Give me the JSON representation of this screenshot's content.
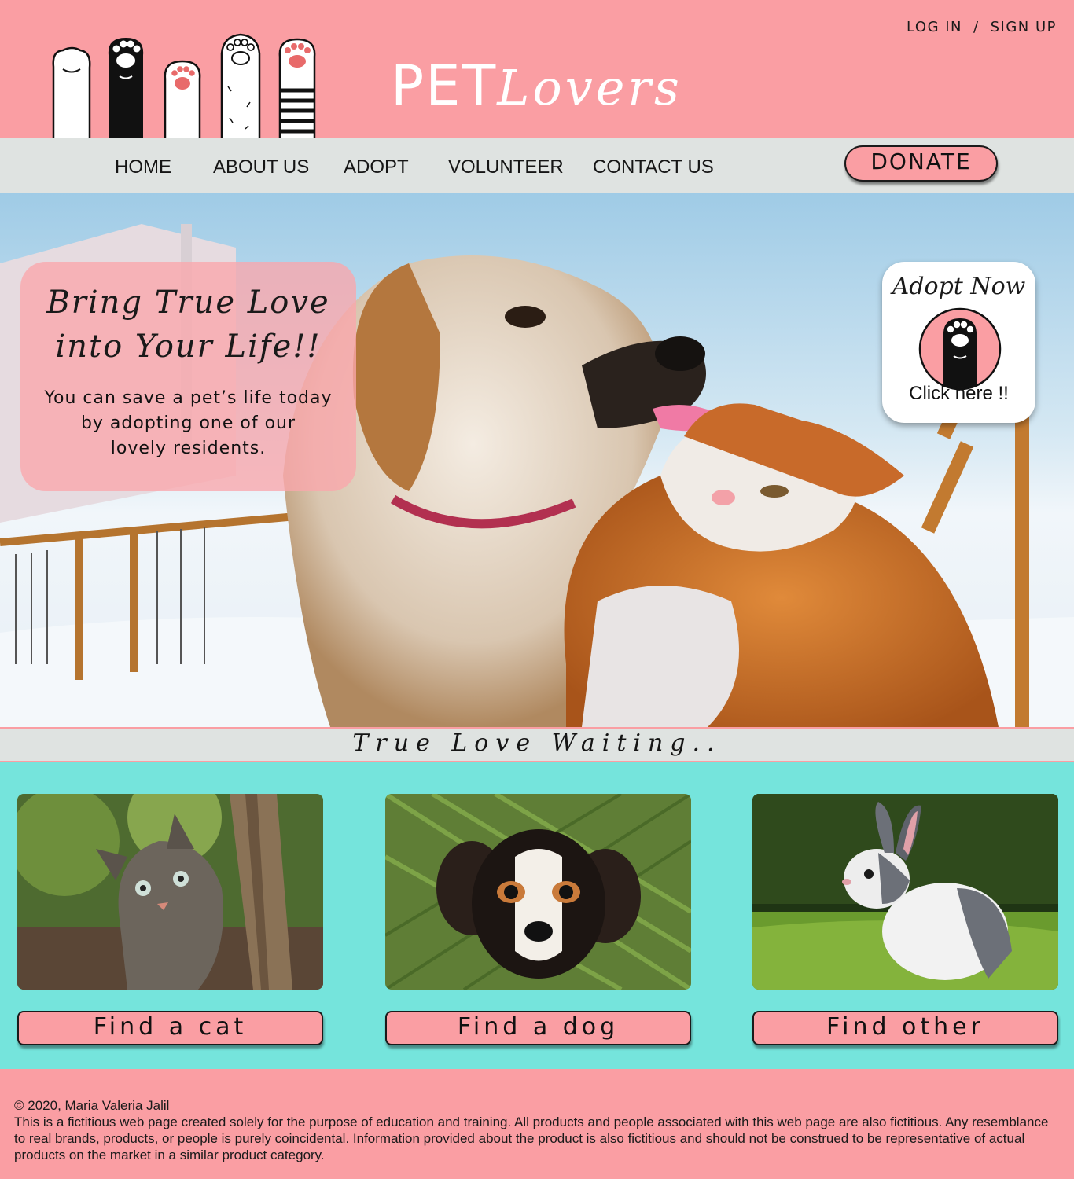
{
  "header": {
    "brand_part1": "PET",
    "brand_part2": "Lovers",
    "login": "LOG IN",
    "separator": "/",
    "signup": "SIGN UP"
  },
  "nav": {
    "items": [
      {
        "label": "HOME"
      },
      {
        "label": "ABOUT US"
      },
      {
        "label": "ADOPT"
      },
      {
        "label": "VOLUNTEER"
      },
      {
        "label": "CONTACT US"
      }
    ],
    "donate_label": "DONATE"
  },
  "hero": {
    "title_line1": "Bring True Love",
    "title_line2": "into Your Life!!",
    "text_line1": "You can save a pet’s life today",
    "text_line2": "by adopting one of our",
    "text_line3": "lovely residents.",
    "adopt_title": "Adopt Now",
    "adopt_cta": "Click here !!"
  },
  "tagline": "True Love Waiting..",
  "pets": [
    {
      "button": "Find a cat"
    },
    {
      "button": "Find a dog"
    },
    {
      "button": "Find other"
    }
  ],
  "footer": {
    "copyright": "© 2020, Maria Valeria Jalil",
    "disclaimer": "This is a fictitious web page created solely for the purpose of education and training. All products and people associated with this web page are also fictitious. Any resemblance to real brands, products, or people is purely coincidental. Information provided about the product is also fictitious and should not be construed to be representative of actual products on the market in a similar product category."
  },
  "colors": {
    "brand_pink": "#fa9ea3",
    "nav_gray": "#dfe3e1",
    "section_teal": "#75e4dc"
  }
}
